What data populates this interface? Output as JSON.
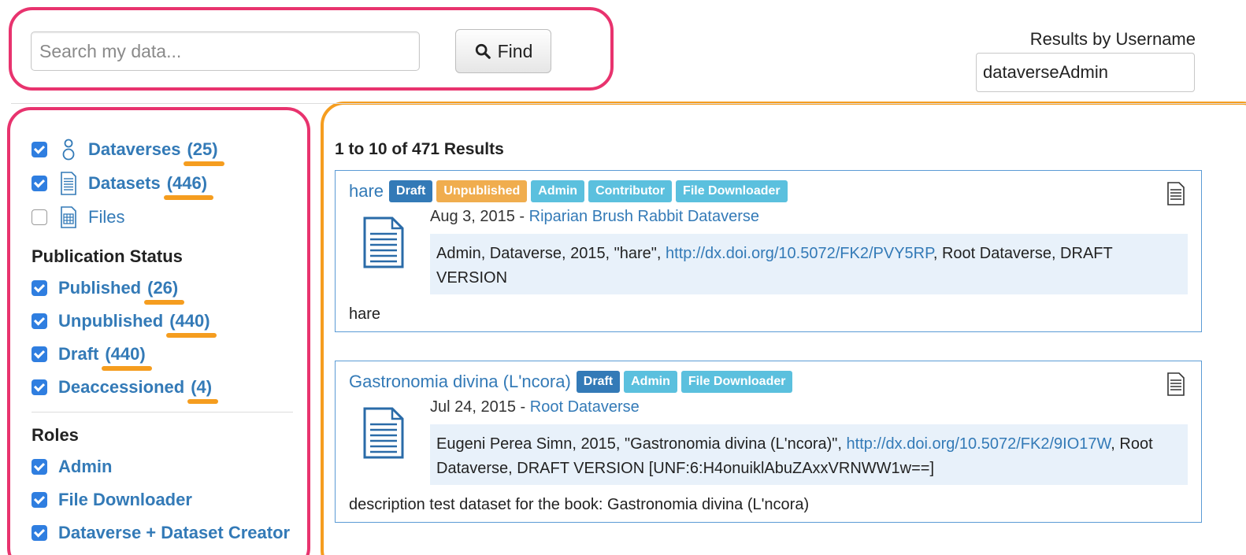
{
  "search": {
    "placeholder": "Search my data...",
    "find_label": "Find"
  },
  "user_filter": {
    "label": "Results by Username",
    "value": "dataverseAdmin"
  },
  "sidebar": {
    "types": [
      {
        "label": "Dataverses",
        "count": "(25)",
        "checked": true
      },
      {
        "label": "Datasets",
        "count": "(446)",
        "checked": true
      },
      {
        "label": "Files",
        "count": "",
        "checked": false
      }
    ],
    "publication_status": {
      "heading": "Publication Status",
      "items": [
        {
          "label": "Published",
          "count": "(26)"
        },
        {
          "label": "Unpublished",
          "count": "(440)"
        },
        {
          "label": "Draft",
          "count": "(440)"
        },
        {
          "label": "Deaccessioned",
          "count": "(4)"
        }
      ]
    },
    "roles": {
      "heading": "Roles",
      "items": [
        {
          "label": "Admin"
        },
        {
          "label": "File Downloader"
        },
        {
          "label": "Dataverse + Dataset Creator"
        }
      ]
    }
  },
  "results": {
    "count_text": "1 to 10 of 471 Results",
    "items": [
      {
        "title": "hare",
        "badges": [
          "Draft",
          "Unpublished",
          "Admin",
          "Contributor",
          "File Downloader"
        ],
        "date": "Aug 3, 2015",
        "parent": "Riparian Brush Rabbit Dataverse",
        "citation_pre": "Admin, Dataverse, 2015, \"hare\", ",
        "citation_link": "http://dx.doi.org/10.5072/FK2/PVY5RP",
        "citation_post": ", Root Dataverse, DRAFT VERSION",
        "description": "hare"
      },
      {
        "title": "Gastronomia divina (L'ncora)",
        "badges": [
          "Draft",
          "Admin",
          "File Downloader"
        ],
        "date": "Jul 24, 2015",
        "parent": "Root Dataverse",
        "citation_pre": "Eugeni Perea Simn, 2015, \"Gastronomia divina (L'ncora)\", ",
        "citation_link": "http://dx.doi.org/10.5072/FK2/9IO17W",
        "citation_post": ", Root Dataverse, DRAFT VERSION [UNF:6:H4onuiklAbuZAxxVRNWW1w==]",
        "description": "description test dataset for the book: Gastronomia divina (L'ncora)"
      }
    ]
  },
  "colors": {
    "link": "#337ab7",
    "annotation_pink": "#e8336e",
    "annotation_orange": "#f59d1f",
    "badge_role": "#5bc0de",
    "badge_unpublished": "#f0ad4e"
  }
}
